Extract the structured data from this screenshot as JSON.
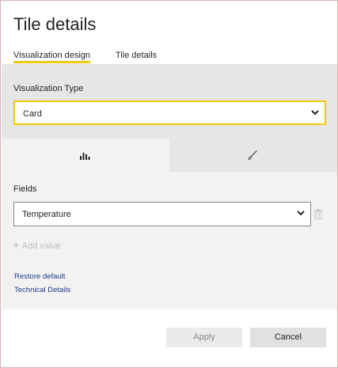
{
  "dialog": {
    "title": "Tile details"
  },
  "tabs": [
    {
      "label": "Visualization design",
      "active": true
    },
    {
      "label": "Tile details",
      "active": false
    }
  ],
  "visualization": {
    "label": "Visualization Type",
    "selected": "Card"
  },
  "sub_tabs": [
    {
      "icon": "bar-chart-icon",
      "active": true
    },
    {
      "icon": "paintbrush-icon",
      "active": false
    }
  ],
  "fields": {
    "label": "Fields",
    "items": [
      {
        "value": "Temperature"
      }
    ],
    "add_value_label": "Add value"
  },
  "links": {
    "restore_default": "Restore default",
    "technical_details": "Technical Details"
  },
  "buttons": {
    "apply": "Apply",
    "cancel": "Cancel"
  },
  "colors": {
    "accent": "#f2c811",
    "link": "#1f3c8c"
  }
}
